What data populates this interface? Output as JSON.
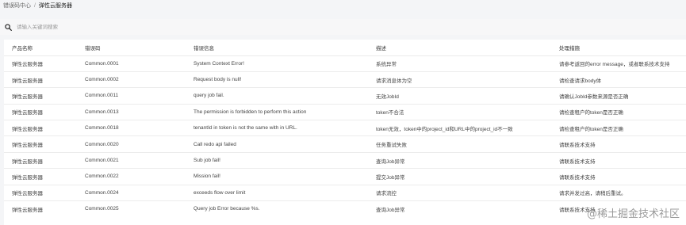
{
  "breadcrumb": {
    "parent": "错误码中心",
    "separator": "/",
    "current": "弹性云服务器"
  },
  "search": {
    "placeholder": "请输入关键词搜索"
  },
  "table": {
    "headers": [
      "产品名称",
      "错误码",
      "错误信息",
      "描述",
      "处理措施"
    ],
    "rows": [
      [
        "弹性云服务器",
        "Common.0001",
        "System Context Error!",
        "系统异常",
        "请参考返回的error message，或者联系技术支持"
      ],
      [
        "弹性云服务器",
        "Common.0002",
        "Request body is null!",
        "请求消息体为空",
        "请检查请求body体"
      ],
      [
        "弹性云服务器",
        "Common.0011",
        "query job fail.",
        "无效JobId",
        "请确认JobId参数来源是否正确"
      ],
      [
        "弹性云服务器",
        "Common.0013",
        "The permission is forbidden to perform this action",
        "token不合法",
        "请检查租户的token是否正确"
      ],
      [
        "弹性云服务器",
        "Common.0018",
        "tenantId in token is not the same with in URL.",
        "token无效，token中的project_id和URL中的project_id不一致",
        "请检查租户的token是否正确"
      ],
      [
        "弹性云服务器",
        "Common.0020",
        "Call redo api failed",
        "任务重试失败",
        "请联系技术支持"
      ],
      [
        "弹性云服务器",
        "Common.0021",
        "Sub job fail!",
        "查询Job异常",
        "请联系技术支持"
      ],
      [
        "弹性云服务器",
        "Common.0022",
        "Mission fail!",
        "提交Job异常",
        "请联系技术支持"
      ],
      [
        "弹性云服务器",
        "Common.0024",
        "exceeds flow over limit",
        "请求流控",
        "请求并发过高，请稍后重试。"
      ],
      [
        "弹性云服务器",
        "Common.0025",
        "Query job Error because %s.",
        "查询Job异常",
        "请联系技术支持"
      ]
    ]
  },
  "watermark": "@稀土掘金技术社区"
}
